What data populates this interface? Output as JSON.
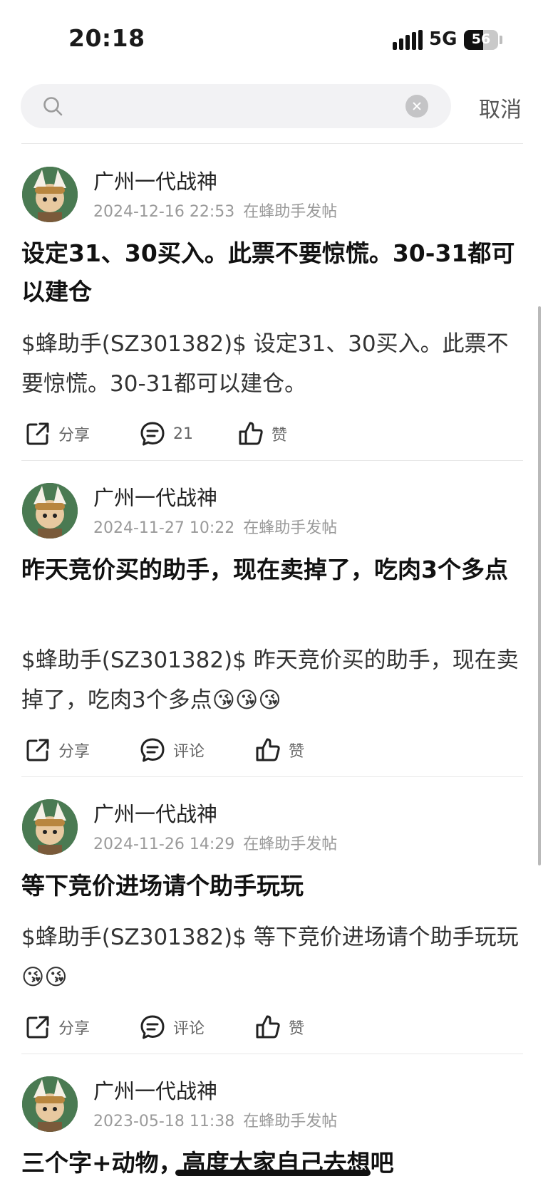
{
  "status_bar": {
    "time": "20:18",
    "network": "5G",
    "battery": "56",
    "battery_level": 0.56
  },
  "search": {
    "placeholder": "",
    "value": "",
    "cancel_label": "取消"
  },
  "posts": [
    {
      "author": "广州一代战神",
      "date": "2024-12-16 22:53",
      "source": "在蜂助手发帖",
      "title": "设定31、30买入。此票不要惊慌。30-31都可以建仓",
      "body": "$蜂助手(SZ301382)$ 设定31、30买入。此票不要惊慌。30-31都可以建仓。",
      "share_label": "分享",
      "comment_label": "21",
      "like_label": "赞"
    },
    {
      "author": "广州一代战神",
      "date": "2024-11-27 10:22",
      "source": "在蜂助手发帖",
      "title": "昨天竞价买的助手，现在卖掉了，吃肉3个多点",
      "body": "$蜂助手(SZ301382)$ 昨天竞价买的助手，现在卖掉了，吃肉3个多点😘😘😘",
      "share_label": "分享",
      "comment_label": "评论",
      "like_label": "赞"
    },
    {
      "author": "广州一代战神",
      "date": "2024-11-26 14:29",
      "source": "在蜂助手发帖",
      "title": "等下竞价进场请个助手玩玩",
      "body": "$蜂助手(SZ301382)$ 等下竞价进场请个助手玩玩😘😘",
      "share_label": "分享",
      "comment_label": "评论",
      "like_label": "赞"
    },
    {
      "author": "广州一代战神",
      "date": "2023-05-18 11:38",
      "source": "在蜂助手发帖",
      "title": "三个字+动物，高度大家自己去想吧"
    }
  ],
  "icons": {
    "search": "search-icon",
    "clear": "clear-icon",
    "share": "share-icon",
    "comment": "comment-icon",
    "like": "thumbs-up-icon"
  }
}
